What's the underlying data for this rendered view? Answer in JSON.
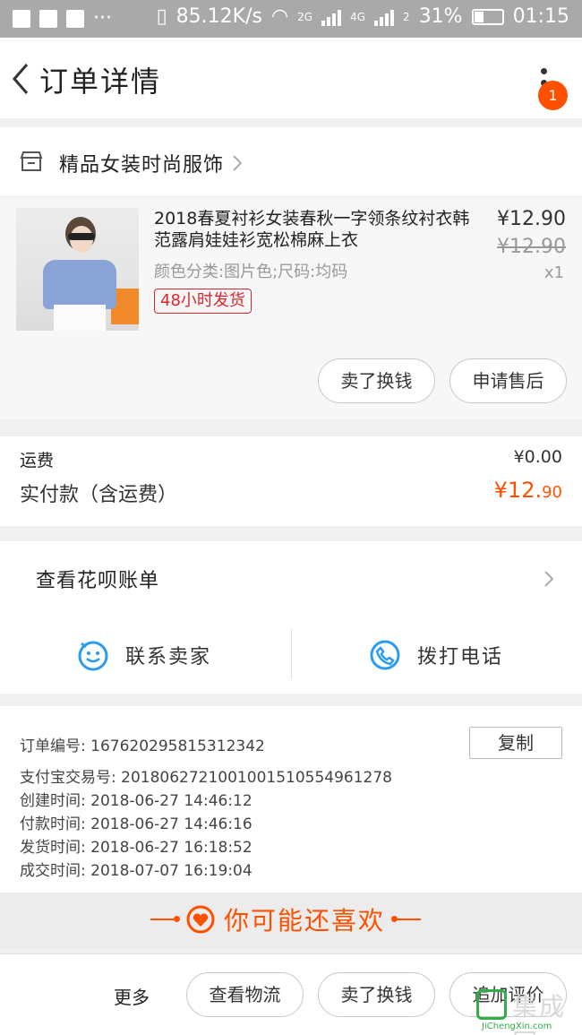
{
  "status_bar": {
    "speed": "85.12K/s",
    "net1": "2G",
    "net2": "4G",
    "sim2": "2",
    "battery": "31%",
    "time": "01:15"
  },
  "nav": {
    "title": "订单详情",
    "badge": "1"
  },
  "shop": {
    "name": "精品女装时尚服饰"
  },
  "item": {
    "title": "2018春夏衬衫女装春秋一字领条纹衬衣韩范露肩娃娃衫宽松棉麻上衣",
    "spec": "颜色分类:图片色;尺码:均码",
    "ship_tag": "48小时发货",
    "price": "¥12.90",
    "original_price": "¥12.90",
    "qty": "x1",
    "sell_label": "卖了换钱",
    "aftersale_label": "申请售后"
  },
  "fees": {
    "shipping_label": "运费",
    "shipping_value": "¥0.00",
    "paid_label": "实付款（含运费）",
    "paid_currency": "¥",
    "paid_int": "12.",
    "paid_dec": "90"
  },
  "huabei": {
    "label": "查看花呗账单"
  },
  "contact": {
    "seller_label": "联系卖家",
    "call_label": "拨打电话"
  },
  "order": {
    "copy_label": "复制",
    "rows": [
      {
        "label": "订单编号:",
        "value": "167620295815312342"
      },
      {
        "label": "支付宝交易号:",
        "value": "2018062721001001510554961278"
      },
      {
        "label": "创建时间:",
        "value": "2018-06-27 14:46:12"
      },
      {
        "label": "付款时间:",
        "value": "2018-06-27 14:46:16"
      },
      {
        "label": "发货时间:",
        "value": "2018-06-27 16:18:52"
      },
      {
        "label": "成交时间:",
        "value": "2018-07-07 16:19:04"
      }
    ]
  },
  "recommend": {
    "title": "你可能还喜欢"
  },
  "bottom_bar": {
    "more_label": "更多",
    "logistics_label": "查看物流",
    "sell_label": "卖了换钱",
    "review_label": "追加评价"
  },
  "watermark": {
    "text": "集成网",
    "url": "JiChengXin.com"
  },
  "colors": {
    "accent": "#ff5000",
    "tag_red": "#e0242e",
    "icon_blue": "#2b9cf2"
  }
}
